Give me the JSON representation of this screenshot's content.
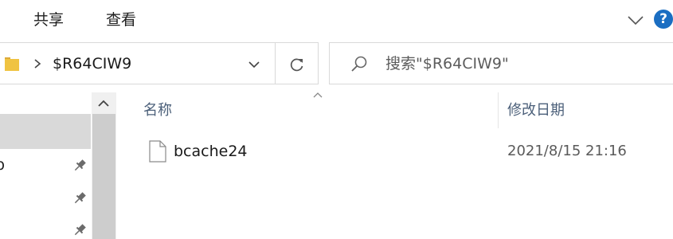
{
  "ribbon": {
    "tabs": [
      {
        "label": "共享"
      },
      {
        "label": "查看"
      }
    ],
    "collapse_icon": "chevron-down-icon",
    "help_label": "?"
  },
  "address_bar": {
    "path": "$R64CIW9",
    "folder_icon": "folder-icon",
    "refresh_icon": "refresh-icon"
  },
  "search": {
    "placeholder": "搜索\"$R64CIW9\""
  },
  "nav_pane": {
    "items": [
      {
        "label": "",
        "selected": true
      },
      {
        "label": "p",
        "pinned": true
      },
      {
        "label": "",
        "pinned": true
      },
      {
        "label": "",
        "pinned": true
      }
    ]
  },
  "file_list": {
    "columns": {
      "name": "名称",
      "date_modified": "修改日期"
    },
    "rows": [
      {
        "name": "bcache24",
        "date_modified": "2021/8/15 21:16",
        "icon": "file-icon"
      }
    ]
  },
  "colors": {
    "accent": "#1b6ec2",
    "header_text": "#4c607a",
    "selection": "#d9d9d9",
    "folder": "#f0c341"
  }
}
